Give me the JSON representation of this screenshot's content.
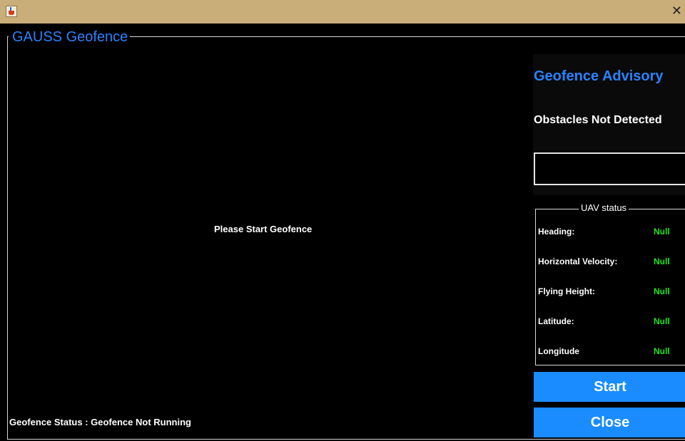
{
  "window": {
    "close_glyph": "✕"
  },
  "main": {
    "title": "GAUSS Geofence",
    "center_message": "Please Start Geofence",
    "status_text": "Geofence Status : Geofence Not Running"
  },
  "advisory": {
    "title": "Geofence Advisory",
    "obstacles_text": "Obstacles Not Detected",
    "message": ""
  },
  "uav_status": {
    "title": "UAV status",
    "rows": [
      {
        "label": "Heading:",
        "value": "Null"
      },
      {
        "label": "Horizontal Velocity:",
        "value": "Null"
      },
      {
        "label": "Flying Height:",
        "value": "Null"
      },
      {
        "label": "Latitude:",
        "value": "Null"
      },
      {
        "label": "Longitude",
        "value": "Null"
      }
    ]
  },
  "buttons": {
    "start": "Start",
    "close": "Close"
  },
  "colors": {
    "accent": "#2b82ff",
    "button": "#1a8cff",
    "value_green": "#19e619",
    "titlebar": "#c9ae7a"
  }
}
